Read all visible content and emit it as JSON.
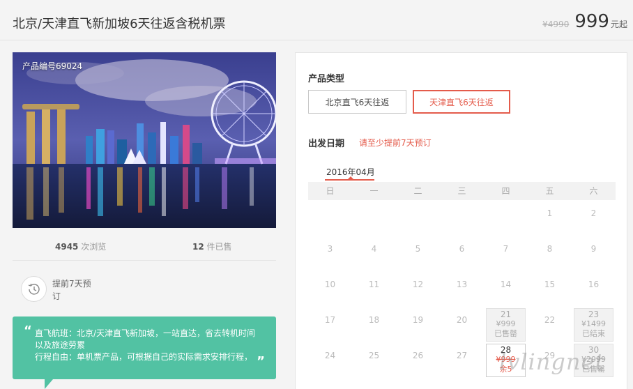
{
  "header": {
    "title": "北京/天津直飞新加坡6天往返含税机票",
    "old_price": "¥4990",
    "price": "999",
    "price_unit": "元起"
  },
  "gallery": {
    "product_code": "产品编号69024"
  },
  "stats": {
    "views_count": "4945",
    "views_label": " 次浏览",
    "sold_count": "12",
    "sold_label": " 件已售"
  },
  "advance": {
    "icon": "clock-icon",
    "text": "提前7天预订"
  },
  "feature": {
    "line1": "直飞航班：北京/天津直飞新加坡，一站直达，省去转机时间以及旅途劳累",
    "line2": "行程自由：单机票产品，可根据自己的实际需求安排行程，",
    "open_quote": "“",
    "close_quote": "”"
  },
  "panel": {
    "type_label": "产品类型",
    "types": [
      {
        "label": "北京直飞6天往返",
        "selected": false
      },
      {
        "label": "天津直飞6天往返",
        "selected": true
      }
    ],
    "date_label": "出发日期",
    "date_note": "请至少提前7天预订",
    "month": "2016年04月",
    "weekdays": [
      "日",
      "一",
      "二",
      "三",
      "四",
      "五",
      "六"
    ],
    "weeks": [
      [
        {
          "d": ""
        },
        {
          "d": ""
        },
        {
          "d": ""
        },
        {
          "d": ""
        },
        {
          "d": ""
        },
        {
          "d": "1"
        },
        {
          "d": "2"
        }
      ],
      [
        {
          "d": "3"
        },
        {
          "d": "4"
        },
        {
          "d": "5"
        },
        {
          "d": "6"
        },
        {
          "d": "7"
        },
        {
          "d": "8"
        },
        {
          "d": "9"
        }
      ],
      [
        {
          "d": "10"
        },
        {
          "d": "11"
        },
        {
          "d": "12"
        },
        {
          "d": "13"
        },
        {
          "d": "14"
        },
        {
          "d": "15"
        },
        {
          "d": "16"
        }
      ],
      [
        {
          "d": "17"
        },
        {
          "d": "18"
        },
        {
          "d": "19"
        },
        {
          "d": "20"
        },
        {
          "d": "21",
          "price": "¥999",
          "status": "已售罄"
        },
        {
          "d": "22"
        },
        {
          "d": "23",
          "price": "¥1499",
          "status": "已结束"
        }
      ],
      [
        {
          "d": "24"
        },
        {
          "d": "25"
        },
        {
          "d": "26"
        },
        {
          "d": "27"
        },
        {
          "d": "28",
          "price": "¥999",
          "status": "余5",
          "available": true
        },
        {
          "d": "29"
        },
        {
          "d": "30",
          "price": "¥2999",
          "status": "已售罄"
        }
      ]
    ]
  },
  "watermark": "lvlingnet",
  "colors": {
    "accent": "#e45b4b",
    "feature_bg": "#52c2a3"
  }
}
